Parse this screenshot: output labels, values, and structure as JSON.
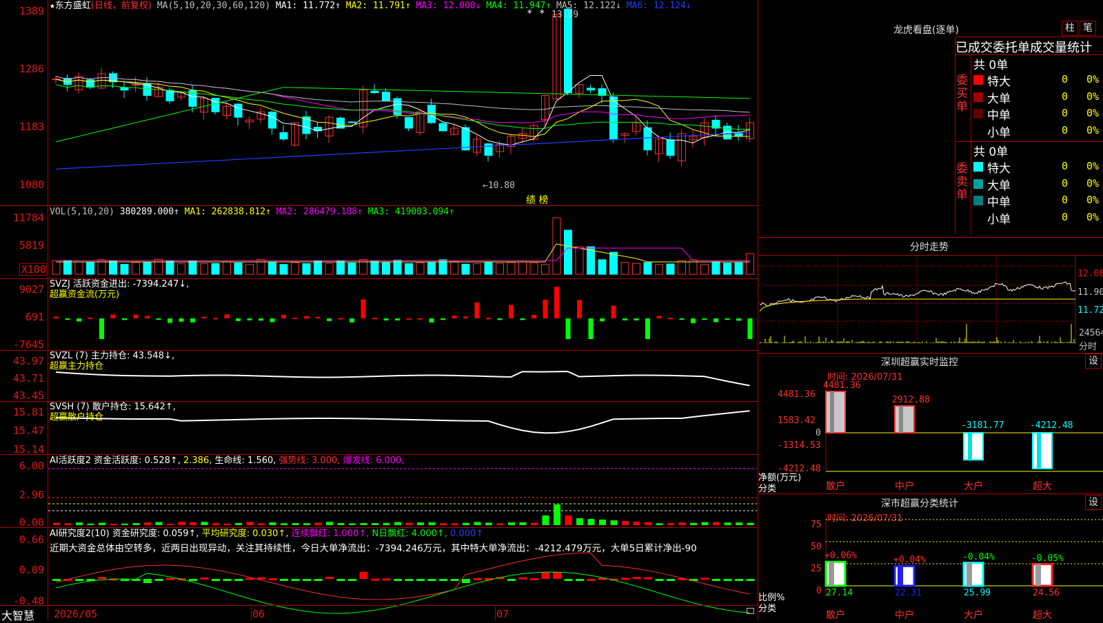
{
  "stock": {
    "name": "东方盛虹",
    "mode": "(日线，前复权)",
    "star": "★"
  },
  "ma_header": {
    "label": "MA(5,10,20,30,60,120)",
    "ma1": "MA1: 11.772↑",
    "ma2": "MA2: 11.791↑",
    "ma3": "MA3: 12.000↓",
    "ma4": "MA4: 11.947↑",
    "ma5": "MA5: 12.122↓",
    "ma6": "MA6: 12.124↓"
  },
  "price_axis": [
    "1389",
    "1286",
    "1183",
    "1080"
  ],
  "price_annotations": {
    "high": "13.89",
    "low": "←10.80",
    "badge": "绩 榜",
    "high_mark": "*"
  },
  "vol_header": {
    "label": "VOL(5,10,20)",
    "value": "380289.000↑",
    "ma1": "MA1: 262838.812↑",
    "ma2": "MA2: 286479.188↑",
    "ma3": "MA3: 419003.094↑"
  },
  "vol_axis": [
    "11784",
    "5819",
    "X100"
  ],
  "svzj": {
    "line1": "SVZJ  活跃资金进出: -7394.247↓,",
    "line2": "超赢资金流(万元)",
    "axis": [
      "9027",
      "691",
      "-7645"
    ]
  },
  "svzl": {
    "line1": "SVZL (7) 主力持仓: 43.548↓,",
    "line2": "超赢主力持仓",
    "axis": [
      "43.97",
      "43.71",
      "43.45"
    ]
  },
  "svsh": {
    "line1": "SVSH (7) 散户持仓: 15.642↑,",
    "line2": "超赢散户持仓",
    "axis": [
      "15.81",
      "15.47",
      "15.14"
    ]
  },
  "ai_active": {
    "a": "AI活跃度2 资金活跃度: 0.528↑,",
    "b": "2.386,",
    "c": "生命线: 1.560,",
    "d": "强势线: 3.000,",
    "e": "爆发线: 6.000,",
    "axis": [
      "6.00",
      "2.96",
      "0.00"
    ]
  },
  "ai_research": {
    "a": "AI研究度2(10) 资金研究度: 0.059↑,",
    "b": "平均研究度: 0.030↑,",
    "c": "连续飘红: 1.000↑,",
    "d": "N日飘红: 4.000↑,",
    "e": "0.000↑",
    "commentary": "近期大资金总体由空转多，近两日出现异动，关注其持续性，今日大单净流出：-7394.246万元，其中特大单净流出：-4212.479万元，大单5日累计净出-90",
    "axis": [
      "0.66",
      "0.09",
      "-0.48"
    ]
  },
  "x_axis": {
    "d1": "2026/05",
    "d2": "06",
    "d3": "07"
  },
  "brand": "大智慧",
  "longhu": {
    "title": "龙虎看盘(逐单)",
    "btn1": "柱",
    "btn2": "笔",
    "section_title": "已成交委托单成交量统计",
    "buy_label": "委买单",
    "sell_label": "委卖单",
    "buy_total": "共 0单",
    "sell_total": "共 0单",
    "buy_rows": [
      {
        "name": "特大",
        "count": "0",
        "pct": "0%",
        "color": "#ff0000"
      },
      {
        "name": "大单",
        "count": "0",
        "pct": "0%",
        "color": "#a00000"
      },
      {
        "name": "中单",
        "count": "0",
        "pct": "0%",
        "color": "#600000"
      },
      {
        "name": "小单",
        "count": "0",
        "pct": "0%",
        "color": "#000000"
      }
    ],
    "sell_rows": [
      {
        "name": "特大",
        "count": "0",
        "pct": "0%",
        "color": "#00ffff"
      },
      {
        "name": "大单",
        "count": "0",
        "pct": "0%",
        "color": "#00a0a0"
      },
      {
        "name": "中单",
        "count": "0",
        "pct": "0%",
        "color": "#008080"
      },
      {
        "name": "小单",
        "count": "0",
        "pct": "0%",
        "color": "#000000"
      }
    ]
  },
  "intraday": {
    "title": "分时走势",
    "axis": [
      "12.08",
      "11.90",
      "11.72"
    ],
    "vol_label": "24564",
    "time_label": "分时"
  },
  "sz_monitor": {
    "title": "深圳超赢实时监控",
    "btn": "设",
    "time": "时间: 2026/07/31",
    "axis": [
      "4481.36",
      "1583.42",
      "0",
      "-1314.53",
      "-4212.48"
    ],
    "net_label": "净额(万元)",
    "cat_label": "分类",
    "bars": [
      {
        "cat": "散户",
        "value": 4481.36,
        "label": "4481.36"
      },
      {
        "cat": "中户",
        "value": 2912.88,
        "label": "2912.88"
      },
      {
        "cat": "大户",
        "value": -3181.77,
        "label": "-3181.77"
      },
      {
        "cat": "超大",
        "value": -4212.48,
        "label": "-4212.48"
      }
    ]
  },
  "sz_class": {
    "title": "深市超赢分类统计",
    "btn": "设",
    "time": "时间: 2026/07/31",
    "axis": [
      "75",
      "50",
      "25",
      "0"
    ],
    "ratio_label": "比例%",
    "cat_label": "分类",
    "bars": [
      {
        "cat": "散户",
        "value": 27.14,
        "label": "27.14",
        "delta": "+0.06%",
        "color": "#00ff00"
      },
      {
        "cat": "中户",
        "value": 22.31,
        "label": "22.31",
        "delta": "+0.04%",
        "color": "#2020ff"
      },
      {
        "cat": "大户",
        "value": 25.99,
        "label": "25.99",
        "delta": "-0.04%",
        "color": "#00ffff"
      },
      {
        "cat": "超大",
        "value": 24.56,
        "label": "24.56",
        "delta": "-0.05%",
        "color": "#ff2020"
      }
    ]
  },
  "colors": {
    "up": "#ff3030",
    "down": "#00ffff",
    "axis": "#b00000",
    "ma1": "#ffffff",
    "ma2": "#ffff00",
    "ma3": "#ff00ff",
    "ma4": "#00ff00",
    "ma5": "#c0c0c0",
    "ma6": "#2040ff"
  }
}
